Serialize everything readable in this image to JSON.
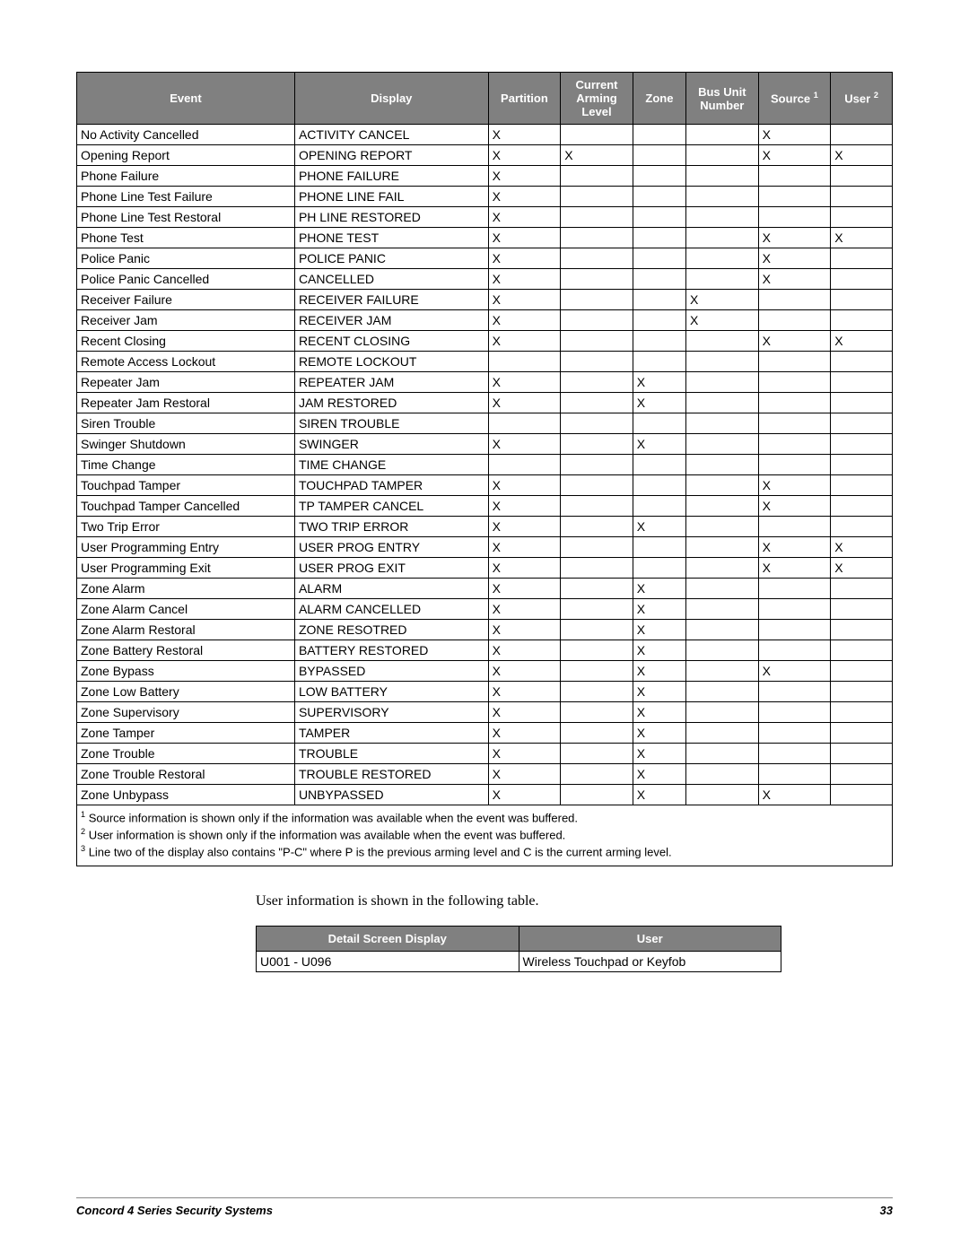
{
  "events_table": {
    "headers": [
      "Event",
      "Display",
      "Partition",
      "Current Arming Level",
      "Zone",
      "Bus Unit Number",
      "Source ¹",
      "User ²"
    ],
    "rows": [
      {
        "event": "No Activity Cancelled",
        "display": "ACTIVITY CANCEL",
        "partition": "X",
        "arming": "",
        "zone": "",
        "bus": "",
        "source": "X",
        "user": ""
      },
      {
        "event": "Opening Report",
        "display": "OPENING REPORT",
        "partition": "X",
        "arming": "X",
        "zone": "",
        "bus": "",
        "source": "X",
        "user": "X"
      },
      {
        "event": "Phone Failure",
        "display": "PHONE FAILURE",
        "partition": "X",
        "arming": "",
        "zone": "",
        "bus": "",
        "source": "",
        "user": ""
      },
      {
        "event": "Phone Line Test Failure",
        "display": "PHONE LINE FAIL",
        "partition": "X",
        "arming": "",
        "zone": "",
        "bus": "",
        "source": "",
        "user": ""
      },
      {
        "event": "Phone Line Test Restoral",
        "display": "PH LINE RESTORED",
        "partition": "X",
        "arming": "",
        "zone": "",
        "bus": "",
        "source": "",
        "user": ""
      },
      {
        "event": "Phone Test",
        "display": "PHONE TEST",
        "partition": "X",
        "arming": "",
        "zone": "",
        "bus": "",
        "source": "X",
        "user": "X"
      },
      {
        "event": "Police Panic",
        "display": "POLICE PANIC",
        "partition": "X",
        "arming": "",
        "zone": "",
        "bus": "",
        "source": "X",
        "user": ""
      },
      {
        "event": "Police Panic Cancelled",
        "display": "CANCELLED",
        "partition": "X",
        "arming": "",
        "zone": "",
        "bus": "",
        "source": "X",
        "user": ""
      },
      {
        "event": "Receiver Failure",
        "display": "RECEIVER FAILURE",
        "partition": "X",
        "arming": "",
        "zone": "",
        "bus": "X",
        "source": "",
        "user": ""
      },
      {
        "event": "Receiver Jam",
        "display": "RECEIVER JAM",
        "partition": "X",
        "arming": "",
        "zone": "",
        "bus": "X",
        "source": "",
        "user": ""
      },
      {
        "event": "Recent Closing",
        "display": "RECENT CLOSING",
        "partition": "X",
        "arming": "",
        "zone": "",
        "bus": "",
        "source": "X",
        "user": "X"
      },
      {
        "event": "Remote Access Lockout",
        "display": "REMOTE LOCKOUT",
        "partition": "",
        "arming": "",
        "zone": "",
        "bus": "",
        "source": "",
        "user": ""
      },
      {
        "event": "Repeater Jam",
        "display": "REPEATER JAM",
        "partition": "X",
        "arming": "",
        "zone": "X",
        "bus": "",
        "source": "",
        "user": ""
      },
      {
        "event": "Repeater Jam Restoral",
        "display": "JAM RESTORED",
        "partition": "X",
        "arming": "",
        "zone": "X",
        "bus": "",
        "source": "",
        "user": ""
      },
      {
        "event": "Siren Trouble",
        "display": "SIREN TROUBLE",
        "partition": "",
        "arming": "",
        "zone": "",
        "bus": "",
        "source": "",
        "user": ""
      },
      {
        "event": "Swinger Shutdown",
        "display": "SWINGER",
        "partition": "X",
        "arming": "",
        "zone": "X",
        "bus": "",
        "source": "",
        "user": ""
      },
      {
        "event": "Time Change",
        "display": "TIME CHANGE",
        "partition": "",
        "arming": "",
        "zone": "",
        "bus": "",
        "source": "",
        "user": ""
      },
      {
        "event": "Touchpad Tamper",
        "display": "TOUCHPAD TAMPER",
        "partition": "X",
        "arming": "",
        "zone": "",
        "bus": "",
        "source": "X",
        "user": ""
      },
      {
        "event": "Touchpad Tamper Cancelled",
        "display": "TP TAMPER CANCEL",
        "partition": "X",
        "arming": "",
        "zone": "",
        "bus": "",
        "source": "X",
        "user": ""
      },
      {
        "event": "Two Trip Error",
        "display": "TWO TRIP ERROR",
        "partition": "X",
        "arming": "",
        "zone": "X",
        "bus": "",
        "source": "",
        "user": ""
      },
      {
        "event": "User Programming Entry",
        "display": "USER PROG ENTRY",
        "partition": "X",
        "arming": "",
        "zone": "",
        "bus": "",
        "source": "X",
        "user": "X"
      },
      {
        "event": "User Programming Exit",
        "display": "USER PROG EXIT",
        "partition": "X",
        "arming": "",
        "zone": "",
        "bus": "",
        "source": "X",
        "user": "X"
      },
      {
        "event": "Zone Alarm",
        "display": "ALARM",
        "partition": "X",
        "arming": "",
        "zone": "X",
        "bus": "",
        "source": "",
        "user": ""
      },
      {
        "event": "Zone Alarm Cancel",
        "display": "ALARM CANCELLED",
        "partition": "X",
        "arming": "",
        "zone": "X",
        "bus": "",
        "source": "",
        "user": ""
      },
      {
        "event": "Zone Alarm Restoral",
        "display": "ZONE RESOTRED",
        "partition": "X",
        "arming": "",
        "zone": "X",
        "bus": "",
        "source": "",
        "user": ""
      },
      {
        "event": "Zone Battery Restoral",
        "display": "BATTERY RESTORED",
        "partition": "X",
        "arming": "",
        "zone": "X",
        "bus": "",
        "source": "",
        "user": ""
      },
      {
        "event": "Zone Bypass",
        "display": "BYPASSED",
        "partition": "X",
        "arming": "",
        "zone": "X",
        "bus": "",
        "source": "X",
        "user": ""
      },
      {
        "event": "Zone Low Battery",
        "display": "LOW BATTERY",
        "partition": "X",
        "arming": "",
        "zone": "X",
        "bus": "",
        "source": "",
        "user": ""
      },
      {
        "event": "Zone Supervisory",
        "display": "SUPERVISORY",
        "partition": "X",
        "arming": "",
        "zone": "X",
        "bus": "",
        "source": "",
        "user": ""
      },
      {
        "event": "Zone Tamper",
        "display": "TAMPER",
        "partition": "X",
        "arming": "",
        "zone": "X",
        "bus": "",
        "source": "",
        "user": ""
      },
      {
        "event": "Zone Trouble",
        "display": "TROUBLE",
        "partition": "X",
        "arming": "",
        "zone": "X",
        "bus": "",
        "source": "",
        "user": ""
      },
      {
        "event": "Zone Trouble Restoral",
        "display": "TROUBLE RESTORED",
        "partition": "X",
        "arming": "",
        "zone": "X",
        "bus": "",
        "source": "",
        "user": ""
      },
      {
        "event": "Zone Unbypass",
        "display": "UNBYPASSED",
        "partition": "X",
        "arming": "",
        "zone": "X",
        "bus": "",
        "source": "X",
        "user": ""
      }
    ]
  },
  "footnotes": {
    "f1": "Source information is shown only if the information was available when the event was buffered.",
    "f2": "User information is shown only if the information was available when the event was buffered.",
    "f3": "Line two of the display also contains \"P-C\" where P is the previous arming level and C is the current arming level."
  },
  "caption": "User information is shown in the following table.",
  "users_table": {
    "headers": [
      "Detail Screen Display",
      "User"
    ],
    "rows": [
      {
        "display": "U001 - U096",
        "user": "Wireless Touchpad or Keyfob"
      }
    ]
  },
  "footer": {
    "title": "Concord  4 Series Security Systems",
    "page": "33"
  },
  "superscripts": {
    "one": "1",
    "two": "2",
    "three": "3"
  }
}
